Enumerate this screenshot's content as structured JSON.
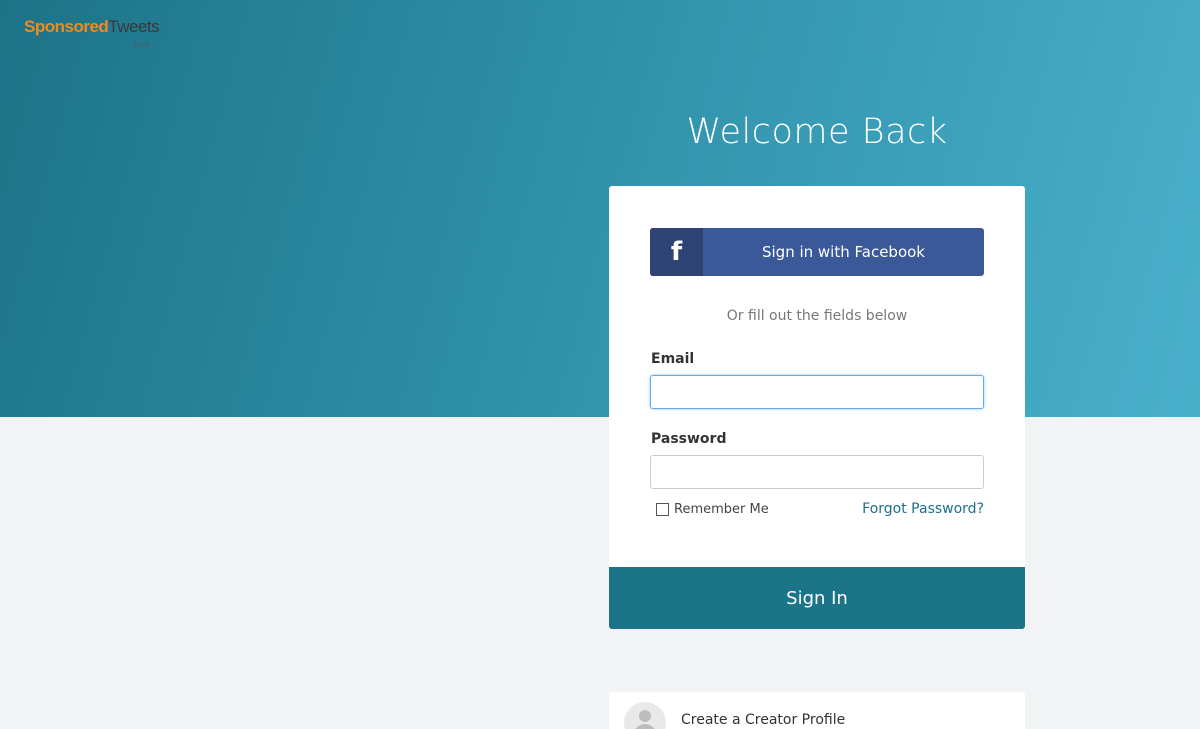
{
  "brand": {
    "logo_part1": "Sponsored",
    "logo_part2": "Tweets",
    "logo_sub": "BETA",
    "logo_color": "#f08a1c"
  },
  "hero": {
    "gradient_colors": [
      "#1d7388",
      "#2f8fa8",
      "#49b0cb"
    ]
  },
  "login": {
    "title": "Welcome Back",
    "facebook_button": {
      "icon": "facebook-icon",
      "label": "Sign in with Facebook"
    },
    "divider_text": "Or fill out the fields below",
    "email": {
      "label": "Email",
      "value": "",
      "focused": true
    },
    "password": {
      "label": "Password",
      "value": ""
    },
    "remember_me": {
      "label": "Remember Me",
      "checked": false
    },
    "forgot_link": "Forgot Password?",
    "submit_label": "Sign In",
    "submit_color": "#1b7488"
  },
  "creator": {
    "icon": "user-avatar-icon",
    "label": "Create a Creator Profile"
  }
}
